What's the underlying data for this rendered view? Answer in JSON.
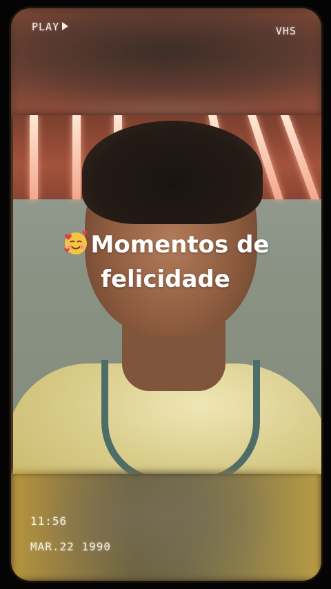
{
  "overlay": {
    "play_label": "PLAY",
    "vhs_label": "VHS",
    "time": "11:56",
    "date": "MAR.22 1990"
  },
  "caption": {
    "emoji_icon": "smiling-face-with-hearts-icon",
    "line1": "Momentos de",
    "line2": "felicidade"
  },
  "colors": {
    "caption_text": "#ffffff",
    "overlay_text": "#f4efe6",
    "frame_glow": "#ffd278"
  }
}
